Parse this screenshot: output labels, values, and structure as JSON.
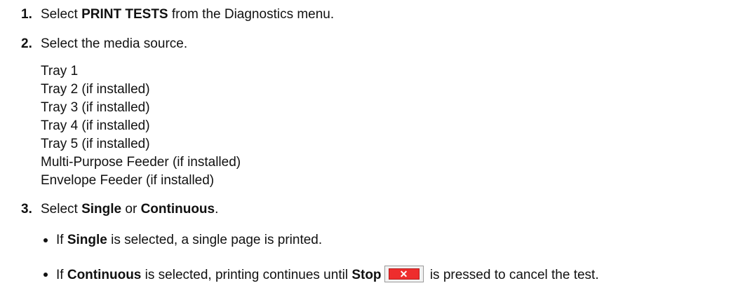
{
  "steps": [
    {
      "number": "1.",
      "prefix": "Select ",
      "bold": "PRINT TESTS",
      "suffix": " from the Diagnostics menu."
    },
    {
      "number": "2.",
      "text": "Select the media source."
    },
    {
      "number": "3.",
      "prefix": "Select ",
      "bold1": "Single",
      "middle": " or ",
      "bold2": "Continuous",
      "suffix": "."
    }
  ],
  "media_sources": [
    "Tray 1",
    "Tray 2 (if installed)",
    "Tray 3 (if installed)",
    "Tray 4 (if installed)",
    "Tray 5 (if installed)",
    "Multi-Purpose Feeder (if installed)",
    "Envelope Feeder (if installed)"
  ],
  "bullets": [
    {
      "prefix": "If ",
      "bold": "Single",
      "suffix": " is selected, a single page is printed."
    },
    {
      "prefix": "If ",
      "bold": "Continuous",
      "middle": " is selected, printing continues until ",
      "bold2": "Stop",
      "suffix": " is pressed to cancel the test."
    }
  ],
  "stop_button": {
    "glyph": "✕",
    "icon": "stop-x-icon",
    "color": "#ee2d2d"
  }
}
